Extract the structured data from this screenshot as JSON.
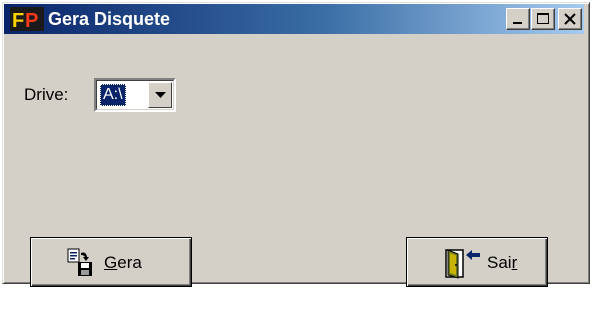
{
  "window": {
    "title": "Gera Disquete",
    "app_icon": "fp-logo-icon",
    "controls": [
      "minimize-icon",
      "maximize-icon",
      "close-icon"
    ]
  },
  "form": {
    "drive_label": "Drive:",
    "drive_value": "A:\\"
  },
  "buttons": {
    "gera": {
      "mnemonic": "G",
      "rest": "era",
      "icon": "copy-to-floppy-icon"
    },
    "sair": {
      "prefix": "Sai",
      "mnemonic": "r",
      "icon": "exit-door-icon"
    }
  },
  "colors": {
    "title_bar_start": "#0a246a",
    "title_bar_end": "#a6caf0",
    "window_face": "#d4d0c8",
    "selection": "#0a246a"
  }
}
